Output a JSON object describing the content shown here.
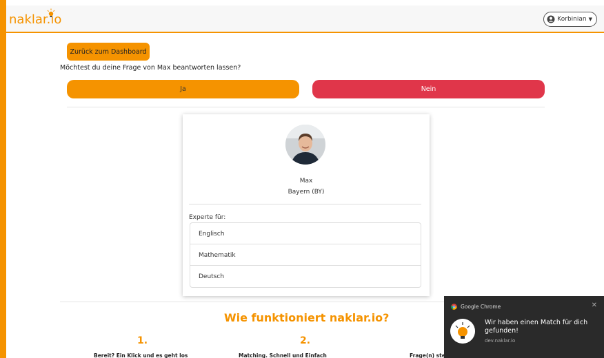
{
  "app": {
    "logo_text": "naklar.io"
  },
  "navbar": {
    "user_name": "Korbinian"
  },
  "actions": {
    "back_label": "Zurück zum Dashboard",
    "question": "Möchtest du deine Frage von Max beantworten lassen?",
    "yes_label": "Ja",
    "no_label": "Nein"
  },
  "profile": {
    "name": "Max",
    "region": "Bayern (BY)",
    "expert_label": "Experte für:",
    "subjects": [
      "Englisch",
      "Mathematik",
      "Deutsch"
    ]
  },
  "how": {
    "title": "Wie funktioniert naklar.io?",
    "steps": [
      {
        "num": "1.",
        "text": "Bereit? Ein Klick und es geht los"
      },
      {
        "num": "2.",
        "text": "Matching. Schnell und Einfach"
      },
      {
        "num": "",
        "text": "Frage(n) stellen. Die Tafel und der Chat"
      }
    ]
  },
  "notification": {
    "app_name": "Google Chrome",
    "message": "Wir haben einen Match für dich gefunden!",
    "source": "dev.naklar.io"
  },
  "colors": {
    "accent": "#f59300",
    "danger": "#e0364a",
    "toast_bg": "#2a2a2a"
  },
  "icons": {
    "user": "user-circle-icon",
    "caret": "caret-down-icon",
    "close": "close-icon",
    "bulb": "lightbulb-icon"
  }
}
